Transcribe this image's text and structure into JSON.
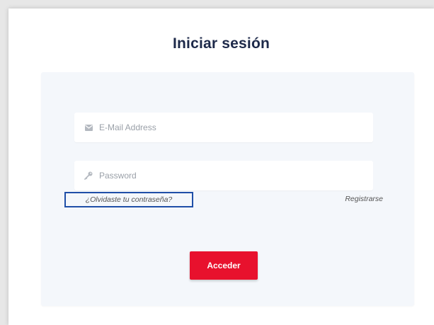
{
  "login": {
    "title": "Iniciar sesión",
    "email_placeholder": "E-Mail Address",
    "email_value": "",
    "password_placeholder": "Password",
    "password_value": "",
    "forgot_label": "¿Olvidaste tu contraseña?",
    "register_label": "Registrarse",
    "submit_label": "Acceder"
  },
  "icons": {
    "email": "envelope-icon",
    "password": "key-icon"
  },
  "colors": {
    "title": "#1e2a4a",
    "accent": "#e8112d",
    "focus_outline": "#1f4fa8",
    "panel": "#f4f7fb",
    "page": "#e7e7e7"
  }
}
